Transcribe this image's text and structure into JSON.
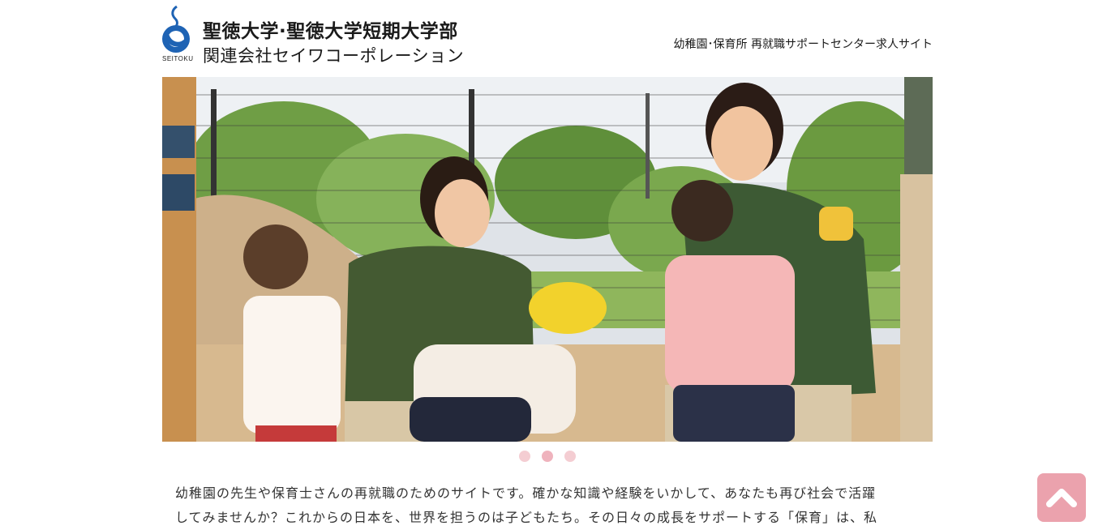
{
  "header": {
    "logo_small_text": "SEITOKU",
    "logo_line1": "聖徳大学·聖徳大学短期大学部",
    "logo_line2": "関連会社セイワコーポレーション",
    "tagline": "幼稚園･保育所 再就職サポートセンター求人サイト"
  },
  "slider": {
    "slides_count": 3,
    "active_index": 1
  },
  "intro": {
    "line1": "幼稚園の先生や保育士さんの再就職のためのサイトです。確かな知識や経験をいかして、あなたも再び社会で活躍",
    "line2": "してみませんか？これからの日本を、世界を担うのは子どもたち。その日々の成長をサポートする「保育」は、私"
  },
  "colors": {
    "accent_pink": "#eba2ad",
    "dot_pink": "#f4cdd2",
    "logo_blue": "#1e63b4"
  },
  "icons": {
    "logo": "seitoku-logo-icon",
    "back_to_top": "chevron-up-icon"
  }
}
